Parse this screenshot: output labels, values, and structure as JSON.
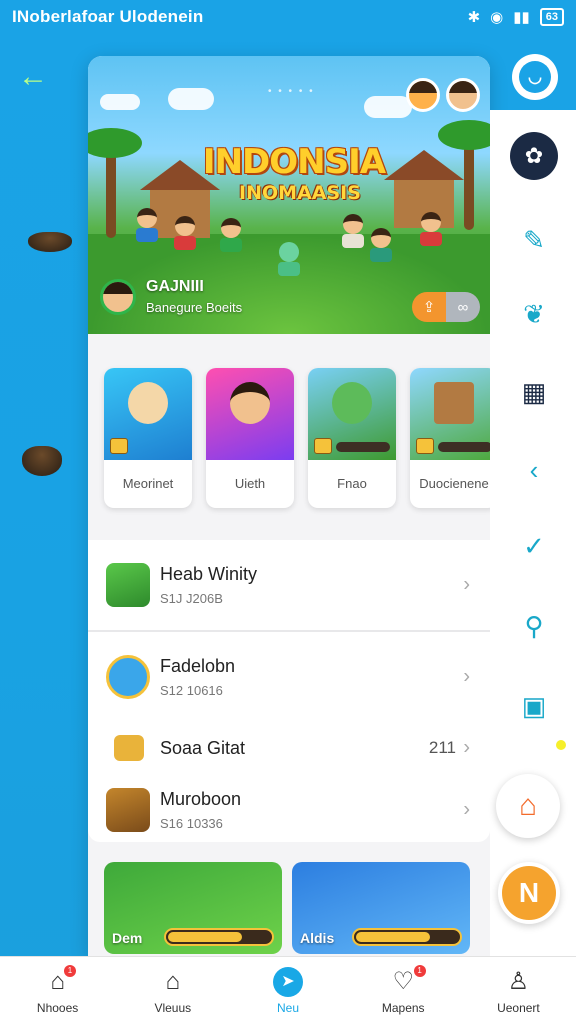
{
  "status_bar": {
    "title": "INoberlafoar Ulodenein",
    "battery": "63"
  },
  "banner": {
    "title": "INDONSIA",
    "subtitle": "INOMAASIS",
    "profile_name": "GAJNIII",
    "profile_sub": "Banegure Boeits"
  },
  "tiles": [
    {
      "label": "Meorinet"
    },
    {
      "label": "Uieth"
    },
    {
      "label": "Fnao"
    },
    {
      "label": "Duocienene"
    }
  ],
  "list": [
    {
      "title": "Heab Winity",
      "meta": "S1J J206B"
    },
    {
      "title": "Fadelobn",
      "meta": "S12 10616"
    },
    {
      "title": "Soaa Gitat",
      "meta": "",
      "value": "211"
    },
    {
      "title": "Muroboon",
      "meta": "S16 10336"
    }
  ],
  "bottom_cards": [
    {
      "label": "Dem"
    },
    {
      "label": "Aldis"
    }
  ],
  "bottom_nav": [
    {
      "label": "Nhooes",
      "badge": "1"
    },
    {
      "label": "Vleuus"
    },
    {
      "label": "Neu"
    },
    {
      "label": "Mapens",
      "badge": "1"
    },
    {
      "label": "Ueonert"
    }
  ],
  "fab": {
    "n_label": "N"
  },
  "colors": {
    "accent": "#19a8e6",
    "orange": "#f5a32e"
  }
}
